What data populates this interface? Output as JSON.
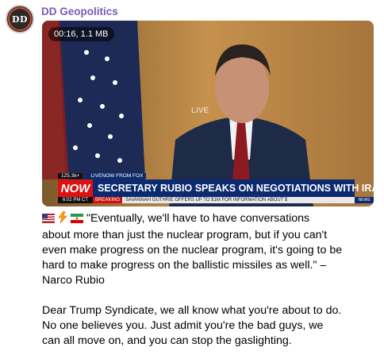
{
  "channel": {
    "avatar_text": "DD",
    "name": "DD Geopolitics"
  },
  "media": {
    "meta": "00:16, 1.1 MB",
    "broadcast": {
      "views": "125.3k+",
      "live_label": "LIVENOW FROM FOX",
      "now_label": "NOW",
      "time": "6:02 PM CT",
      "headline": "SECRETARY RUBIO SPEAKS ON NEGOTIATIONS WITH IRAN",
      "subticker_tag": "BREAKING",
      "subticker": "SAVANNAH GUTHRIE OFFERS UP TO $1M FOR INFORMATION ABOUT $",
      "news_tag": "NEWS"
    }
  },
  "post": {
    "emojis": [
      "us-flag",
      "lightning",
      "iran-flag"
    ],
    "lines": [
      "\"Eventually, we'll have to have conversations",
      "about more than just the nuclear program, but if you can't",
      "even make progress on the nuclear program, it's going to be",
      "hard to make progress on the ballistic missiles as well.\" –",
      "Narco Rubio",
      "",
      "Dear Trump Syndicate, we all know what you're about to do.",
      "No one believes you. Just admit you're the bad guys, we",
      "can all move on, and you can stop the gaslighting."
    ]
  },
  "colors": {
    "sender": "#7b5bb3",
    "headline_bg": "#0b2a6f",
    "now_bg": "#dd1111"
  }
}
